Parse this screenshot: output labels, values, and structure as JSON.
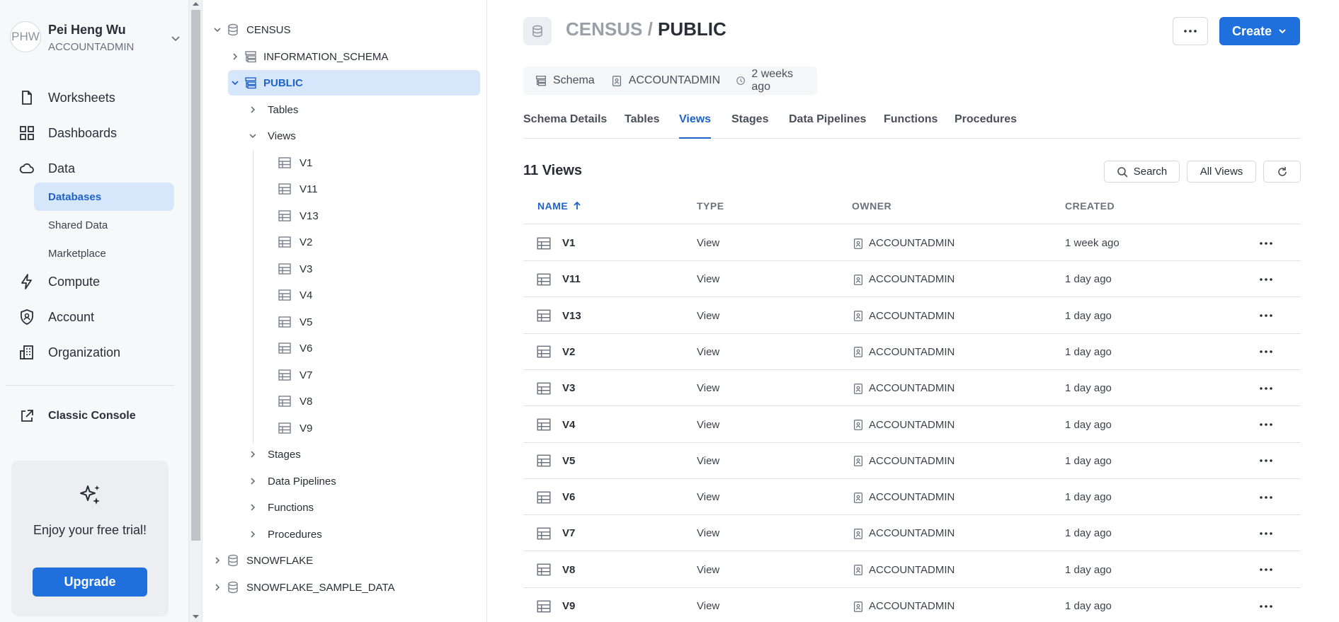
{
  "user": {
    "initials": "PHW",
    "name": "Pei Heng Wu",
    "role": "ACCOUNTADMIN"
  },
  "nav": {
    "items": [
      {
        "label": "Worksheets",
        "icon": "file-icon"
      },
      {
        "label": "Dashboards",
        "icon": "grid-icon"
      },
      {
        "label": "Data",
        "icon": "cloud-icon"
      },
      {
        "label": "Compute",
        "icon": "lightning-icon"
      },
      {
        "label": "Account",
        "icon": "shield-user-icon"
      },
      {
        "label": "Organization",
        "icon": "building-icon"
      }
    ],
    "data_sub": [
      "Databases",
      "Shared Data",
      "Marketplace"
    ],
    "classic_console": "Classic Console",
    "trial_text": "Enjoy your free trial!",
    "upgrade": "Upgrade"
  },
  "tree": {
    "census": "CENSUS",
    "information_schema": "INFORMATION_SCHEMA",
    "public": "PUBLIC",
    "tables": "Tables",
    "views": "Views",
    "view_items": [
      "V1",
      "V11",
      "V13",
      "V2",
      "V3",
      "V4",
      "V5",
      "V6",
      "V7",
      "V8",
      "V9"
    ],
    "stages": "Stages",
    "data_pipelines": "Data Pipelines",
    "functions": "Functions",
    "procedures": "Procedures",
    "snowflake": "SNOWFLAKE",
    "snowflake_sample": "SNOWFLAKE_SAMPLE_DATA"
  },
  "header": {
    "db": "CENSUS",
    "sep": " / ",
    "schema": "PUBLIC",
    "create": "Create"
  },
  "meta": {
    "kind": "Schema",
    "owner": "ACCOUNTADMIN",
    "created": "2 weeks ago"
  },
  "tabs": [
    "Schema Details",
    "Tables",
    "Views",
    "Stages",
    "Data Pipelines",
    "Functions",
    "Procedures"
  ],
  "active_tab": "Views",
  "list": {
    "count_label": "11 Views",
    "search": "Search",
    "filter": "All Views",
    "columns": [
      "NAME",
      "TYPE",
      "OWNER",
      "CREATED"
    ],
    "rows": [
      {
        "name": "V1",
        "type": "View",
        "owner": "ACCOUNTADMIN",
        "created": "1 week ago"
      },
      {
        "name": "V11",
        "type": "View",
        "owner": "ACCOUNTADMIN",
        "created": "1 day ago"
      },
      {
        "name": "V13",
        "type": "View",
        "owner": "ACCOUNTADMIN",
        "created": "1 day ago"
      },
      {
        "name": "V2",
        "type": "View",
        "owner": "ACCOUNTADMIN",
        "created": "1 day ago"
      },
      {
        "name": "V3",
        "type": "View",
        "owner": "ACCOUNTADMIN",
        "created": "1 day ago"
      },
      {
        "name": "V4",
        "type": "View",
        "owner": "ACCOUNTADMIN",
        "created": "1 day ago"
      },
      {
        "name": "V5",
        "type": "View",
        "owner": "ACCOUNTADMIN",
        "created": "1 day ago"
      },
      {
        "name": "V6",
        "type": "View",
        "owner": "ACCOUNTADMIN",
        "created": "1 day ago"
      },
      {
        "name": "V7",
        "type": "View",
        "owner": "ACCOUNTADMIN",
        "created": "1 day ago"
      },
      {
        "name": "V8",
        "type": "View",
        "owner": "ACCOUNTADMIN",
        "created": "1 day ago"
      },
      {
        "name": "V9",
        "type": "View",
        "owner": "ACCOUNTADMIN",
        "created": "1 day ago"
      }
    ]
  },
  "colors": {
    "accent": "#1f6fdd",
    "selected_bg": "#d6e6fb"
  }
}
